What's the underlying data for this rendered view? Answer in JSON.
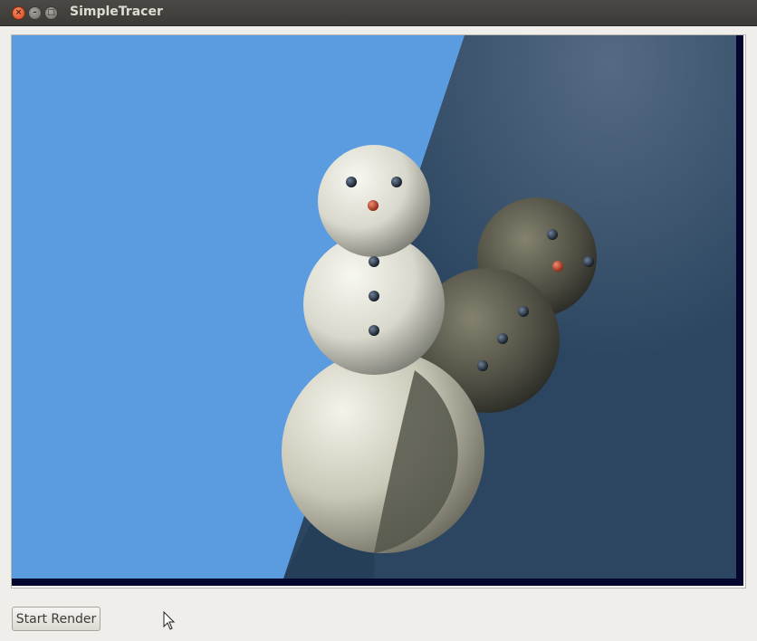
{
  "window": {
    "title": "SimpleTracer",
    "controls": {
      "close": "×",
      "minimize": "–",
      "maximize": "□"
    }
  },
  "viewport": {
    "content": "rendered-scene",
    "scene_colors": {
      "sky": "#5b9bdf",
      "wall": "#2e4a66",
      "border": "#05062e",
      "snow": "#e7e6dd",
      "button_eyes": "#1f2c3c",
      "nose": "#c8432a"
    }
  },
  "controls": {
    "start_render_label": "Start Render"
  },
  "cursor": {
    "icon": "mouse-pointer-icon"
  }
}
